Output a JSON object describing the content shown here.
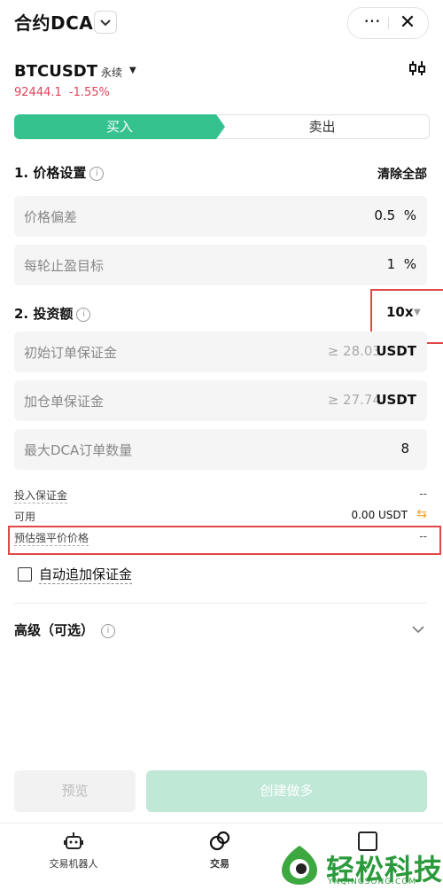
{
  "header": {
    "title": "合约DCA",
    "more_label": "···",
    "close_label": "✕"
  },
  "market": {
    "symbol": "BTCUSDT",
    "type": "永续",
    "price": "92444.1",
    "change": "-1.55%"
  },
  "tabs": {
    "buy": "买入",
    "sell": "卖出"
  },
  "price_settings": {
    "heading": "1. 价格设置",
    "clear_all": "清除全部",
    "fields": [
      {
        "label": "价格偏差",
        "value": "0.5",
        "unit": "%"
      },
      {
        "label": "每轮止盈目标",
        "value": "1",
        "unit": "%"
      }
    ]
  },
  "investment": {
    "heading": "2. 投资额",
    "leverage": "10x",
    "fields": [
      {
        "label": "初始订单保证金",
        "hint": "≥ 28.03",
        "unit": "USDT"
      },
      {
        "label": "加仓单保证金",
        "hint": "≥ 27.74",
        "unit": "USDT"
      },
      {
        "label": "最大DCA订单数量",
        "value": "8"
      }
    ]
  },
  "summary": {
    "margin_label": "投入保证金",
    "margin_value": "--",
    "available_label": "可用",
    "available_value": "0.00 USDT",
    "liq_label": "预估强平价价格",
    "liq_value": "--"
  },
  "auto_margin": {
    "label": "自动追加保证金",
    "checked": false
  },
  "advanced": {
    "label": "高级（可选）"
  },
  "actions": {
    "preview": "预览",
    "create": "创建做多"
  },
  "bottom_nav": [
    {
      "label": "交易机器人"
    },
    {
      "label": "交易"
    }
  ],
  "watermark": {
    "text": "轻松科技",
    "sub": "YNQINGSONG.COM"
  },
  "colors": {
    "accent": "#36c28f",
    "negative": "#e0435b",
    "highlight": "#e04848",
    "swap": "#f2a531"
  }
}
